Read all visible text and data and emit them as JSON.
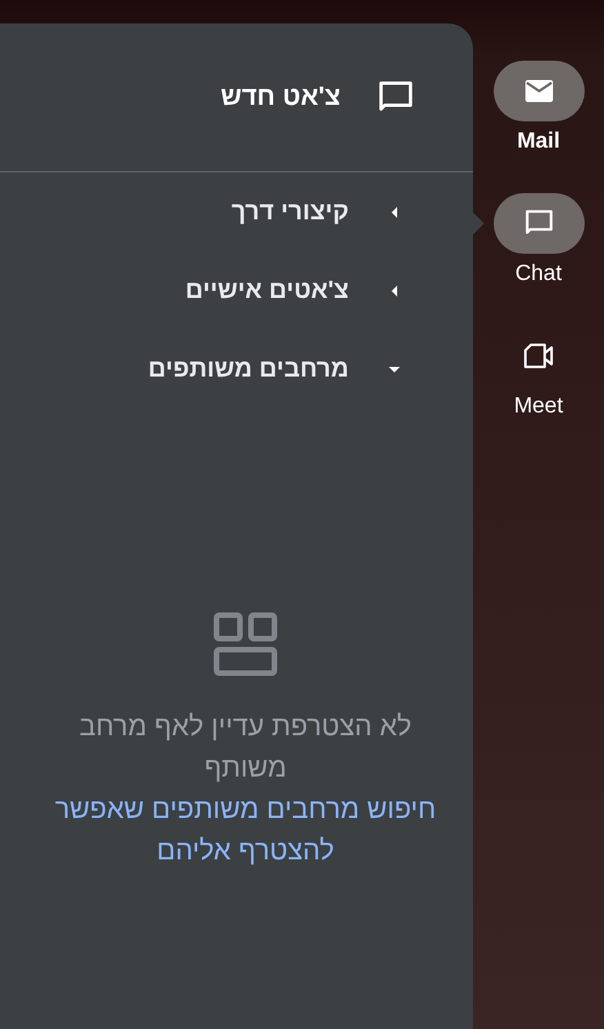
{
  "new_chat": {
    "label": "צ'אט חדש"
  },
  "sections": [
    {
      "label": "קיצורי דרך",
      "expanded": false
    },
    {
      "label": "צ'אטים אישיים",
      "expanded": false
    },
    {
      "label": "מרחבים משותפים",
      "expanded": true
    }
  ],
  "empty_state": {
    "message": "לא הצטרפת עדיין לאף מרחב משותף",
    "link": "חיפוש מרחבים משותפים שאפשר להצטרף אליהם"
  },
  "rail": [
    {
      "kind": "mail",
      "label": "Mail",
      "highlighted": true,
      "selected": false,
      "bold": true
    },
    {
      "kind": "chat",
      "label": "Chat",
      "highlighted": true,
      "selected": true,
      "bold": false
    },
    {
      "kind": "meet",
      "label": "Meet",
      "highlighted": false,
      "selected": false,
      "bold": false
    }
  ]
}
